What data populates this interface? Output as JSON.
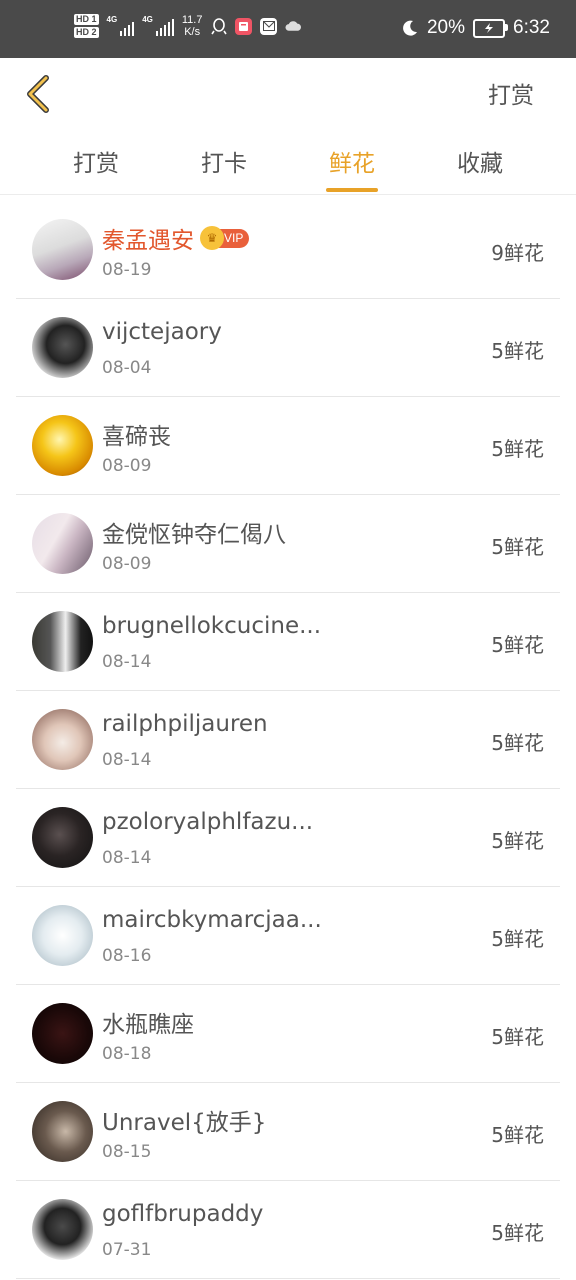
{
  "status_bar": {
    "hd1": "HD 1",
    "hd2": "HD 2",
    "net1": "4G",
    "net2": "4G",
    "speed_value": "11.7",
    "speed_unit": "K/s",
    "battery": "20%",
    "time": "6:32",
    "icons": [
      "qq-icon",
      "book-app-icon",
      "mail-app-icon",
      "cloud-icon"
    ]
  },
  "header": {
    "back_label": "back",
    "action": "打赏"
  },
  "tabs": [
    {
      "label": "打赏",
      "active": false
    },
    {
      "label": "打卡",
      "active": false
    },
    {
      "label": "鲜花",
      "active": true
    },
    {
      "label": "收藏",
      "active": false
    }
  ],
  "vip_badge": "VIP",
  "rows": [
    {
      "name": "秦孟遇安",
      "date": "08-19",
      "count": "9鲜花",
      "vip": true
    },
    {
      "name": "vijctejaory",
      "date": "08-04",
      "count": "5鲜花"
    },
    {
      "name": "喜碲丧",
      "date": "08-09",
      "count": "5鲜花"
    },
    {
      "name": "金傥怄钟夺仁偈八",
      "date": "08-09",
      "count": "5鲜花"
    },
    {
      "name": "brugnellokcucine...",
      "date": "08-14",
      "count": "5鲜花"
    },
    {
      "name": "railphpiljauren",
      "date": "08-14",
      "count": "5鲜花"
    },
    {
      "name": "pzoloryalphlfazu...",
      "date": "08-14",
      "count": "5鲜花"
    },
    {
      "name": "maircbkymarcjaa...",
      "date": "08-16",
      "count": "5鲜花"
    },
    {
      "name": "水瓶瞧座",
      "date": "08-18",
      "count": "5鲜花"
    },
    {
      "name": "Unravel{放手}",
      "date": "08-15",
      "count": "5鲜花"
    },
    {
      "name": "goflfbrupaddy",
      "date": "07-31",
      "count": "5鲜花"
    }
  ],
  "colors": {
    "accent": "#e8a228",
    "vip_name": "#e2572d",
    "statusbar": "#4a4a4a"
  }
}
